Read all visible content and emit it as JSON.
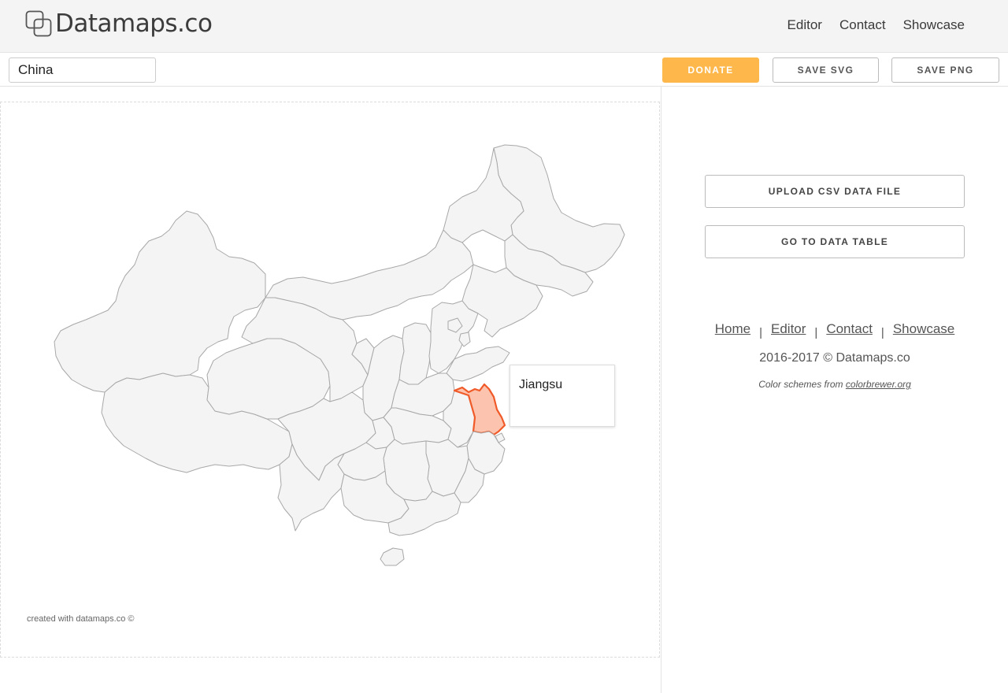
{
  "header": {
    "logo_text": "Datamaps.co",
    "nav": [
      "Editor",
      "Contact",
      "Showcase"
    ]
  },
  "toolbar": {
    "search_value": "China",
    "donate_label": "DONATE",
    "save_svg_label": "SAVE SVG",
    "save_png_label": "SAVE PNG"
  },
  "map": {
    "credit": "created with datamaps.co ©",
    "tooltip_label": "Jiangsu",
    "region_fill": "#f4f4f4",
    "region_stroke": "#a8a8a8",
    "highlight_fill": "#fcc3ae",
    "highlight_stroke": "#f05a28"
  },
  "panel": {
    "upload_label": "UPLOAD CSV DATA FILE",
    "table_label": "GO TO DATA TABLE",
    "footer_links": [
      "Home",
      "Editor",
      "Contact",
      "Showcase"
    ],
    "separator": "|",
    "copyright": "2016-2017 © Datamaps.co",
    "schemes_prefix": "Color schemes from ",
    "schemes_link": "colorbrewer.org"
  },
  "colors": {
    "donate": "#fdb74a",
    "header_bg": "#f4f4f4"
  }
}
